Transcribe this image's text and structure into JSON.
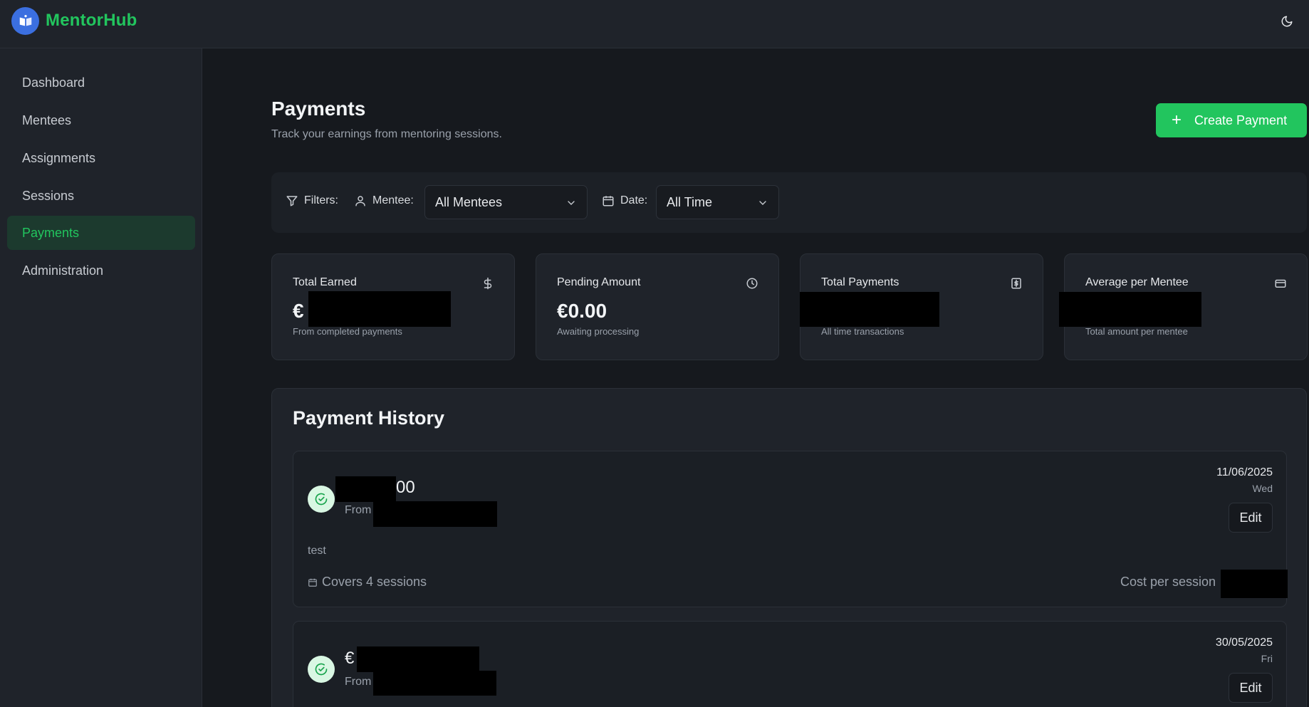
{
  "app": {
    "brand": "MentorHub"
  },
  "sidebar": {
    "items": [
      {
        "label": "Dashboard"
      },
      {
        "label": "Mentees"
      },
      {
        "label": "Assignments"
      },
      {
        "label": "Sessions"
      },
      {
        "label": "Payments",
        "active": true
      },
      {
        "label": "Administration"
      }
    ]
  },
  "page": {
    "title": "Payments",
    "subtitle": "Track your earnings from mentoring sessions.",
    "create_label": "Create Payment"
  },
  "filters": {
    "label": "Filters:",
    "mentee_label": "Mentee:",
    "mentee_value": "All Mentees",
    "date_label": "Date:",
    "date_value": "All Time"
  },
  "stats": [
    {
      "title": "Total Earned",
      "value": "€",
      "desc": "From completed payments",
      "icon": "dollar-icon"
    },
    {
      "title": "Pending Amount",
      "value": "€0.00",
      "desc": "Awaiting processing",
      "icon": "clock-icon"
    },
    {
      "title": "Total Payments",
      "value": "",
      "desc": "All time transactions",
      "icon": "receipt-icon"
    },
    {
      "title": "Average per Mentee",
      "value": "",
      "desc": "Total amount per mentee",
      "icon": "credit-card-icon"
    }
  ],
  "history": {
    "title": "Payment History",
    "items": [
      {
        "amount": "00",
        "from": "From",
        "date": "11/06/2025",
        "weekday": "Wed",
        "edit": "Edit",
        "note": "test",
        "covers": "Covers 4 sessions",
        "cost_label": "Cost per session"
      },
      {
        "amount": "€",
        "from": "From",
        "date": "30/05/2025",
        "weekday": "Fri",
        "edit": "Edit"
      }
    ]
  },
  "colors": {
    "accent": "#22c55e",
    "background": "#16191e",
    "surface": "#1f232a"
  }
}
